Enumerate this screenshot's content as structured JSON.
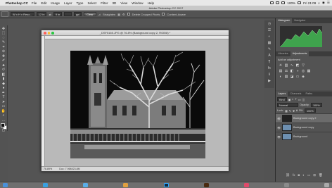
{
  "menubar": {
    "app_name": "Photoshop CC",
    "items": [
      "File",
      "Edit",
      "Image",
      "Layer",
      "Type",
      "Select",
      "Filter",
      "3D",
      "View",
      "Window",
      "Help"
    ],
    "battery": "100%",
    "clock": "Fri 21:09"
  },
  "app_title": "Adobe Photoshop CC 2017",
  "options": {
    "style": "W x H x Reso...",
    "width": "12 in",
    "height": "9 in",
    "resolution": "ppi",
    "clear_label": "Clear",
    "straighten_label": "Straighten",
    "delete_cropped_label": "Delete Cropped Pixels",
    "content_aware_label": "Content-Aware"
  },
  "document": {
    "title": "_DSF5165.JPG @ 76.8% (Background copy 2, RGB/8) *",
    "zoom": "76.89%",
    "doc_size": "Doc: 7.96M/23.8M"
  },
  "panels": {
    "histogram_tab": "Histogram",
    "navigator_tab": "Navigator",
    "libraries_tab": "Libraries",
    "adjustments_tab": "Adjustments",
    "add_adjustment": "Add an adjustment",
    "layers_tab": "Layers",
    "channels_tab": "Channels",
    "paths_tab": "Paths",
    "kind_label": "Kind",
    "blend_mode": "Normal",
    "opacity_label": "Opacity:",
    "opacity_value": "100%",
    "lock_label": "Lock:",
    "fill_label": "Fill:",
    "fill_value": "100%",
    "layers": [
      {
        "name": "Background copy 2",
        "active": true
      },
      {
        "name": "Background copy",
        "active": false
      },
      {
        "name": "Background",
        "active": false
      }
    ]
  },
  "colors": {
    "ps_blue": "#31a8ff",
    "histogram_green": "#3fa34d",
    "traffic_red": "#fc5f57",
    "traffic_yellow": "#fdbc2e",
    "traffic_green": "#28c840"
  }
}
